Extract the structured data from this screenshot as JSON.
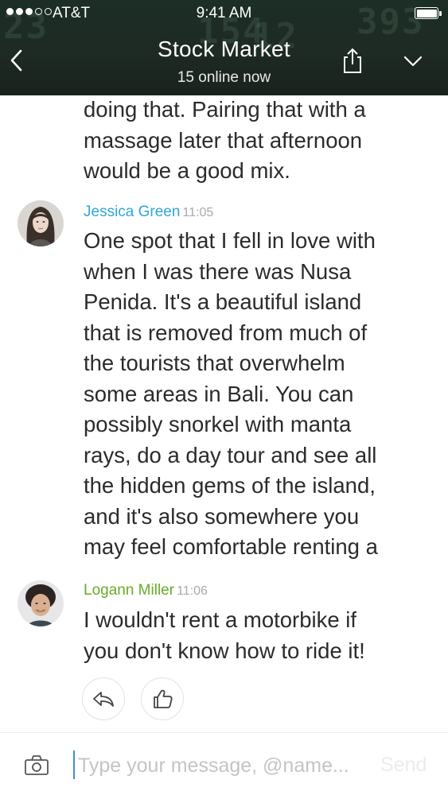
{
  "status_bar": {
    "carrier": "AT&T",
    "time": "9:41 AM",
    "signal_bars_filled": 3,
    "signal_bars_total": 5
  },
  "header": {
    "title": "Stock Market",
    "subtitle": "15 online now",
    "background_ticker": [
      "23",
      "154",
      "12",
      "393"
    ]
  },
  "feed": {
    "continued_text": [
      "doing that. Pairing that with a",
      "massage later that afternoon",
      "would be a good mix."
    ],
    "messages": [
      {
        "author": "Jessica Green",
        "author_color": "#2fa6d8",
        "time": "11:05",
        "avatar_icon": "woman-portrait",
        "lines": [
          "One spot that I fell in love with",
          "when I was there was Nusa",
          "Penida. It's a beautiful island",
          "that is removed from much of",
          "the tourists that overwhelm",
          "some areas in Bali. You can",
          "possibly snorkel with manta",
          "rays, do a day tour and see all",
          "the hidden gems of the island,",
          "and it's also somewhere you",
          "may feel comfortable renting a"
        ]
      },
      {
        "author": "Logann Miller",
        "author_color": "#6aaa2a",
        "time": "11:06",
        "avatar_icon": "man-portrait",
        "lines": [
          "I wouldn't rent a motorbike if",
          "you don't know how to ride it!"
        ]
      }
    ],
    "actions": {
      "reply_icon": "reply-icon",
      "like_icon": "thumbs-up-icon"
    }
  },
  "composer": {
    "placeholder": "Type your message, @name...",
    "send_label": "Send",
    "camera_icon": "camera-icon"
  }
}
